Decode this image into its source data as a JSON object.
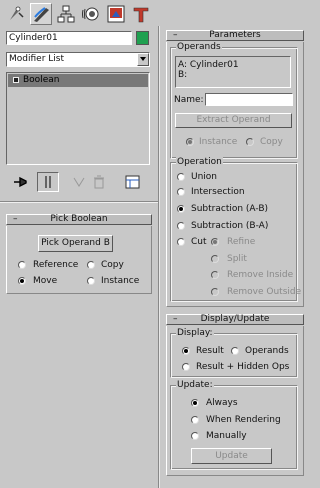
{
  "toolbar": {
    "icons": [
      "create-icon",
      "modify-icon",
      "hierarchy-icon",
      "motion-icon",
      "display-icon",
      "utilities-icon"
    ]
  },
  "object": {
    "name": "Cylinder01",
    "color": "#1fa050"
  },
  "modifier_list": {
    "label": "Modifier List"
  },
  "stack": {
    "items": [
      "Boolean"
    ]
  },
  "stack_buttons": [
    "pin-stack-icon",
    "show-end-result-icon",
    "make-unique-icon",
    "remove-modifier-icon",
    "configure-modifier-sets-icon"
  ],
  "pick_boolean": {
    "title": "Pick Boolean",
    "button": "Pick Operand B",
    "options": [
      {
        "label": "Reference",
        "selected": false
      },
      {
        "label": "Copy",
        "selected": false
      },
      {
        "label": "Move",
        "selected": true
      },
      {
        "label": "Instance",
        "selected": false
      }
    ]
  },
  "parameters": {
    "title": "Parameters",
    "operands": {
      "title": "Operands",
      "list": [
        "A: Cylinder01",
        "B:"
      ],
      "name_label": "Name:",
      "name_value": "",
      "extract_button": "Extract Operand",
      "instance_label": "Instance",
      "copy_label": "Copy"
    },
    "operation": {
      "title": "Operation",
      "options": [
        "Union",
        "Intersection",
        "Subtraction (A-B)",
        "Subtraction (B-A)",
        "Cut"
      ],
      "selected": "Subtraction (A-B)",
      "cut_options": [
        "Refine",
        "Split",
        "Remove Inside",
        "Remove Outside"
      ]
    }
  },
  "display_update": {
    "title": "Display/Update",
    "display": {
      "title": "Display:",
      "options": [
        "Result",
        "Operands",
        "Result + Hidden Ops"
      ],
      "selected": "Result"
    },
    "update": {
      "title": "Update:",
      "options": [
        "Always",
        "When Rendering",
        "Manually"
      ],
      "selected": "Always",
      "button": "Update"
    }
  }
}
